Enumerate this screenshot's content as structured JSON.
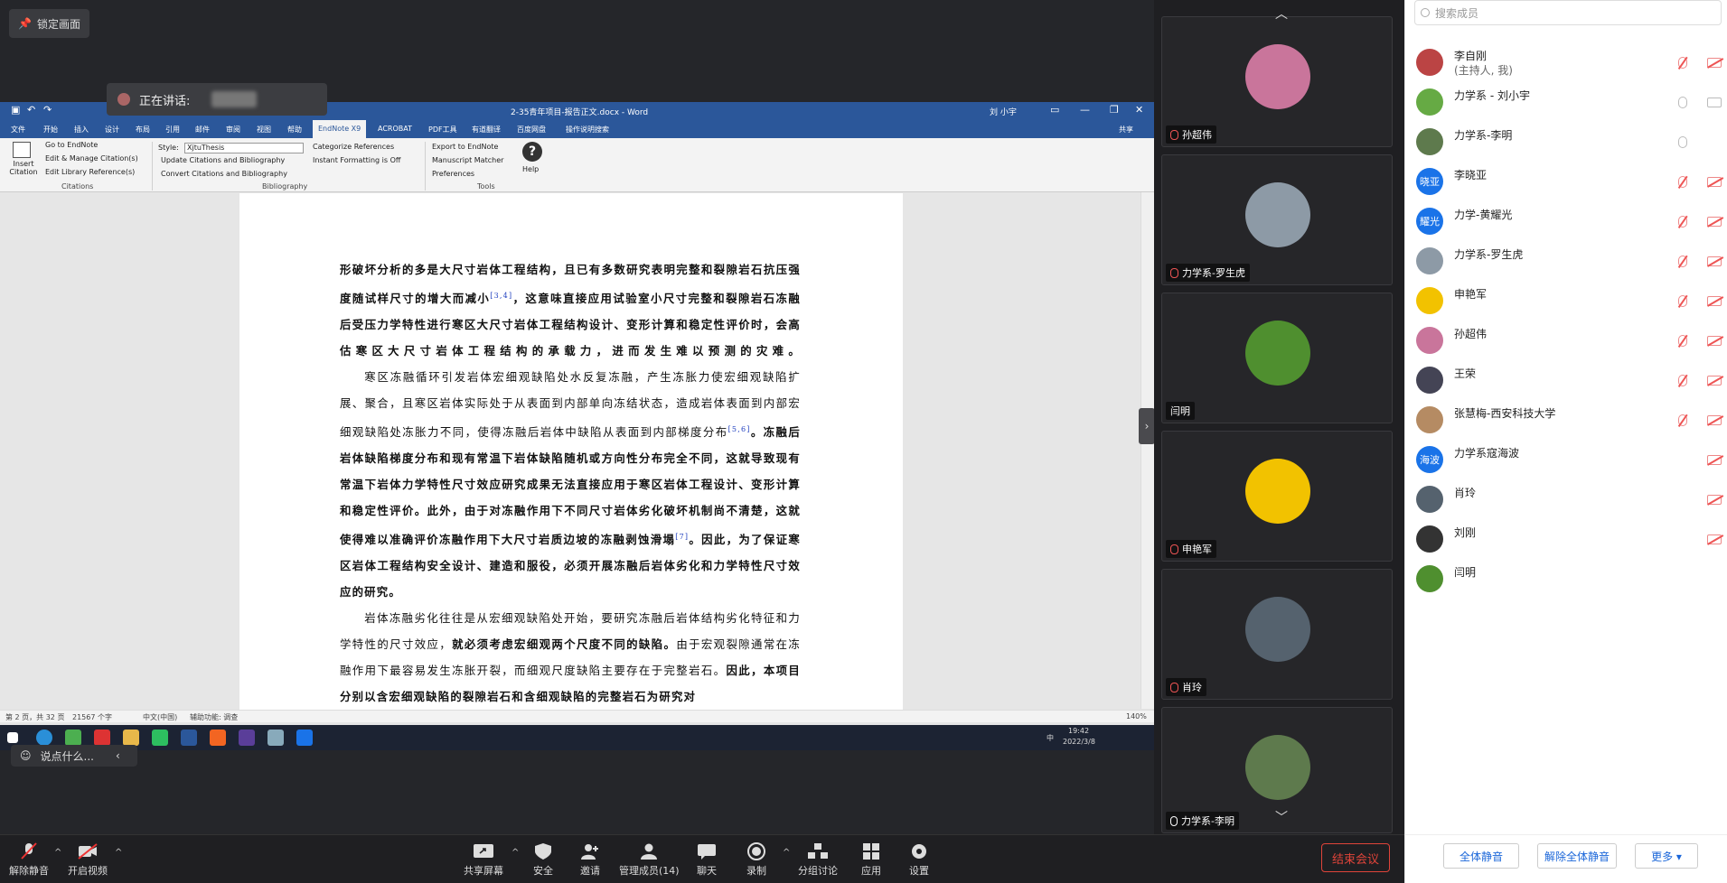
{
  "share": {
    "lock_label": "锁定画面",
    "speaking_label": "正在讲话:",
    "say_placeholder": "说点什么..."
  },
  "word": {
    "title": "2-35青年项目-报告正文.docx  -  Word",
    "user": "刘 小宇",
    "share_label": "共享",
    "menu": [
      "文件",
      "开始",
      "插入",
      "设计",
      "布局",
      "引用",
      "邮件",
      "审阅",
      "视图",
      "帮助",
      "EndNote X9",
      "ACROBAT",
      "PDF工具",
      "有道翻译",
      "百度网盘",
      "操作说明搜索"
    ],
    "active_tab": "EndNote X9",
    "ribbon": {
      "insert_citation": "Insert Citation",
      "go_to": "Go to EndNote",
      "edit_manage": "Edit & Manage Citation(s)",
      "edit_library": "Edit Library Reference(s)",
      "group_citations": "Citations",
      "style_label": "Style:",
      "style_value": "XjtuThesis",
      "update": "Update Citations and Bibliography",
      "convert": "Convert Citations and Bibliography",
      "categorize": "Categorize References",
      "instant": "Instant Formatting is Off",
      "group_bibliography": "Bibliography",
      "export": "Export to EndNote",
      "matcher": "Manuscript Matcher",
      "prefs": "Preferences",
      "help": "Help",
      "group_tools": "Tools"
    },
    "status": {
      "page": "第 2 页，共 32 页",
      "words": "21567 个字",
      "lang": "中文(中国)",
      "access": "辅助功能: 调查",
      "zoom": "140%"
    }
  },
  "document": {
    "p1": "形破坏分析的多是大尺寸岩体工程结构，且已有多数研究表明完整和裂隙岩石抗压强度随试样尺寸的增大而减小",
    "p1_ref": "[3,4]",
    "p1b": "，这意味直接应用试验室小尺寸完整和裂隙岩石冻融后受压力学特性进行寒区大尺寸岩体工程结构设计、变形计算和稳定性评价时，会高估寒区大尺寸岩体工程结构的承载力，进而发生难以预测的灾难。",
    "p2a": "寒区冻融循环引发岩体宏细观缺陷处水反复冻融，产生冻胀力使宏细观缺陷扩展、聚合，且寒区岩体实际处于从表面到内部单向冻结状态，造成岩体表面到内部宏细观缺陷处冻胀力不同，使得冻融后岩体中缺陷从表面到内部梯度分布",
    "p2_ref1": "[5,6]",
    "p2b": "。冻融后岩体缺陷梯度分布和现有常温下岩体缺陷随机或方向性分布完全不同，这就导致现有常温下岩体力学特性尺寸效应研究成果无法直接应用于寒区岩体工程设计、变形计算和稳定性评价。此外，由于对冻融作用下不同尺寸岩体劣化破坏机制尚不清楚，这就使得难以准确评价冻融作用下大尺寸岩质边坡的冻融剥蚀滑塌",
    "p2_ref2": "[7]",
    "p2c": "。因此，为了保证寒区岩体工程结构安全设计、建造和服役，必须开展冻融后岩体劣化和力学特性尺寸效应的研究。",
    "p3a": "岩体冻融劣化往往是从宏细观缺陷处开始，要研究冻融后岩体结构劣化特征和力学特性的尺寸效应，",
    "p3b": "就必须考虑宏细观两个尺度不同的缺陷。",
    "p3c": "由于宏观裂隙通常在冻融作用下最容易发生冻胀开裂，而细观尺度缺陷主要存在于完整岩石。",
    "p4": "因此，本项目分别以含宏细观缺陷的裂隙岩石和含细观缺陷的完整岩石为研究对"
  },
  "taskbar": {
    "time": "19:42",
    "date": "2022/3/8",
    "ime": "中"
  },
  "videos": [
    {
      "name": "孙超伟",
      "muted": true,
      "color": "#c9759b"
    },
    {
      "name": "力学系-罗生虎",
      "muted": true,
      "color": "#8d9aa6"
    },
    {
      "name": "闫明",
      "muted": false,
      "color": "#4f8f2f"
    },
    {
      "name": "申艳军",
      "muted": true,
      "color": "#f2c200"
    },
    {
      "name": "肖玲",
      "muted": true,
      "color": "#55626e"
    },
    {
      "name": "力学系-李明",
      "muted": false,
      "color": "#5e7a4d"
    }
  ],
  "members": {
    "search_placeholder": "搜索成员",
    "list": [
      {
        "name": "李自刚",
        "sub": "(主持人, 我)",
        "av": "",
        "color": "#b44",
        "mic": "muted",
        "cam": "muted"
      },
      {
        "name": "力学系 - 刘小宇",
        "sub": "",
        "av": "",
        "color": "#6a4",
        "mic": "on",
        "cam": "on"
      },
      {
        "name": "力学系-李明",
        "sub": "",
        "av": "",
        "color": "#5e7a4d",
        "mic": "on",
        "cam": "none"
      },
      {
        "name": "李晓亚",
        "sub": "",
        "av": "晓亚",
        "color": "#1a73e8",
        "mic": "muted",
        "cam": "muted"
      },
      {
        "name": "力学-黄耀光",
        "sub": "",
        "av": "耀光",
        "color": "#1a73e8",
        "mic": "muted",
        "cam": "muted"
      },
      {
        "name": "力学系-罗生虎",
        "sub": "",
        "av": "",
        "color": "#8d9aa6",
        "mic": "muted",
        "cam": "muted"
      },
      {
        "name": "申艳军",
        "sub": "",
        "av": "",
        "color": "#f2c200",
        "mic": "muted",
        "cam": "muted"
      },
      {
        "name": "孙超伟",
        "sub": "",
        "av": "",
        "color": "#c9759b",
        "mic": "muted",
        "cam": "muted"
      },
      {
        "name": "王荣",
        "sub": "",
        "av": "",
        "color": "#445",
        "mic": "muted",
        "cam": "muted"
      },
      {
        "name": "张慧梅-西安科技大学",
        "sub": "",
        "av": "",
        "color": "#b58b63",
        "mic": "muted",
        "cam": "muted"
      },
      {
        "name": "力学系寇海波",
        "sub": "",
        "av": "海波",
        "color": "#1a73e8",
        "mic": "none",
        "cam": "muted"
      },
      {
        "name": "肖玲",
        "sub": "",
        "av": "",
        "color": "#55626e",
        "mic": "none",
        "cam": "muted"
      },
      {
        "name": "刘刚",
        "sub": "",
        "av": "",
        "color": "#333",
        "mic": "none",
        "cam": "muted"
      },
      {
        "name": "闫明",
        "sub": "",
        "av": "",
        "color": "#4f8f2f",
        "mic": "none",
        "cam": "none"
      }
    ],
    "mute_all": "全体静音",
    "unmute_all": "解除全体静音",
    "more": "更多 ▾"
  },
  "toolbar": {
    "unmute": "解除静音",
    "start_video": "开启视频",
    "share_screen": "共享屏幕",
    "security": "安全",
    "invite": "邀请",
    "manage": "管理成员(14)",
    "chat": "聊天",
    "record": "录制",
    "breakout": "分组讨论",
    "apps": "应用",
    "settings": "设置",
    "end": "结束会议"
  }
}
